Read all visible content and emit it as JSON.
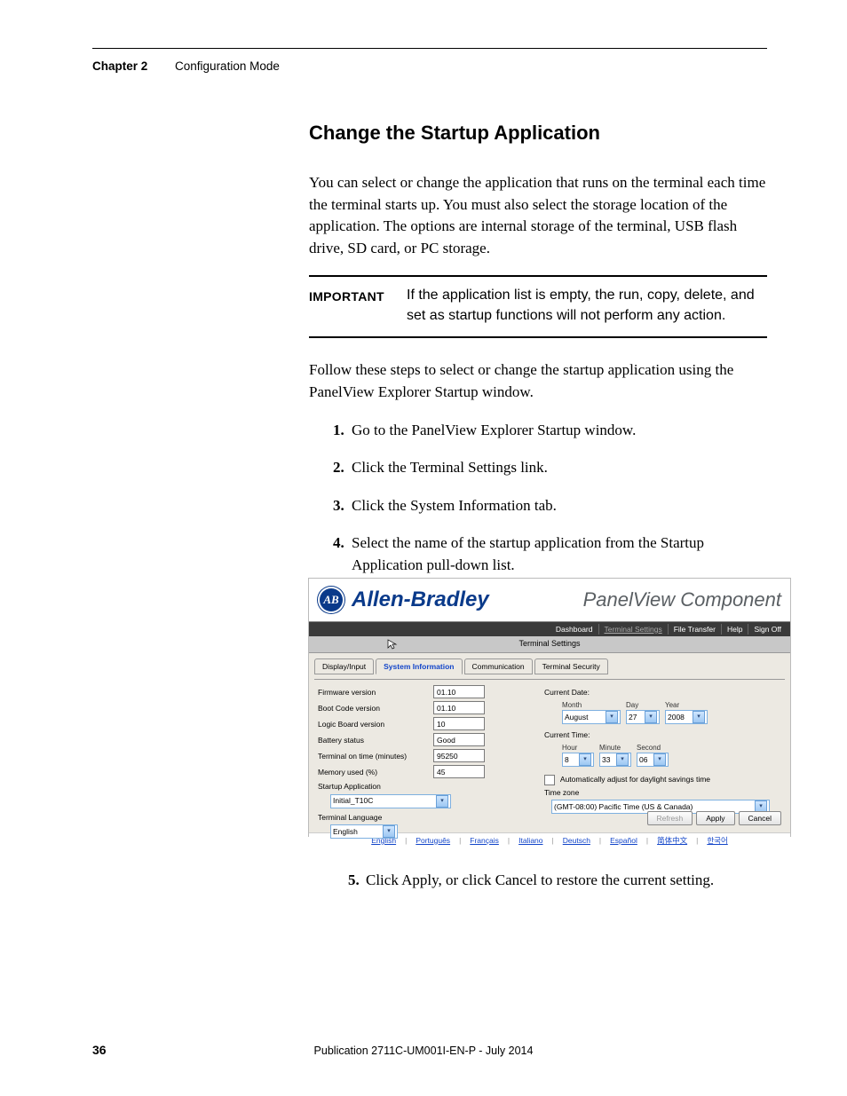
{
  "header": {
    "chapter": "Chapter 2",
    "section": "Configuration Mode"
  },
  "title": "Change the Startup Application",
  "intro": "You can select or change the application that runs on the terminal each time the terminal starts up. You must also select the storage location of the application. The options are internal storage of the terminal, USB flash drive, SD card, or PC storage.",
  "important": {
    "label": "IMPORTANT",
    "text": "If the application list is empty, the run, copy, delete, and set as startup functions will not perform any action."
  },
  "lead": "Follow these steps to select or change the startup application using the PanelView Explorer Startup window.",
  "steps": [
    "Go to the PanelView Explorer Startup window.",
    "Click the Terminal Settings link.",
    "Click the System Information tab.",
    "Select the name of the startup application from the Startup Application pull-down list."
  ],
  "shot": {
    "brand": "Allen-Bradley",
    "product": "PanelView Component",
    "nav": [
      "Dashboard",
      "Terminal Settings",
      "File Transfer",
      "Help",
      "Sign Off"
    ],
    "subheader": "Terminal Settings",
    "tabs": [
      "Display/Input",
      "System Information",
      "Communication",
      "Terminal Security"
    ],
    "left": {
      "firmware_lbl": "Firmware version",
      "firmware_val": "01.10",
      "boot_lbl": "Boot Code version",
      "boot_val": "01.10",
      "logic_lbl": "Logic Board version",
      "logic_val": "10",
      "batt_lbl": "Battery status",
      "batt_val": "Good",
      "ontime_lbl": "Terminal on time (minutes)",
      "ontime_val": "95250",
      "mem_lbl": "Memory used (%)",
      "mem_val": "45",
      "startup_lbl": "Startup Application",
      "startup_val": "Initial_T10C",
      "lang_lbl": "Terminal Language",
      "lang_val": "English"
    },
    "right": {
      "curdate_lbl": "Current Date:",
      "month_lbl": "Month",
      "day_lbl": "Day",
      "year_lbl": "Year",
      "month_val": "August",
      "day_val": "27",
      "year_val": "2008",
      "curtime_lbl": "Current Time:",
      "hour_lbl": "Hour",
      "min_lbl": "Minute",
      "sec_lbl": "Second",
      "hour_val": "8",
      "min_val": "33",
      "sec_val": "06",
      "dst_lbl": "Automatically adjust for daylight savings time",
      "tz_lbl": "Time zone",
      "tz_val": "(GMT-08:00) Pacific Time (US & Canada)"
    },
    "buttons": {
      "refresh": "Refresh",
      "apply": "Apply",
      "cancel": "Cancel"
    },
    "langs": [
      "English",
      "Português",
      "Français",
      "Italiano",
      "Deutsch",
      "Español",
      "简体中文",
      "한국어"
    ]
  },
  "step5": "Click Apply, or click Cancel to restore the current setting.",
  "footer": {
    "page": "36",
    "pub": "Publication 2711C-UM001I-EN-P - July 2014"
  }
}
